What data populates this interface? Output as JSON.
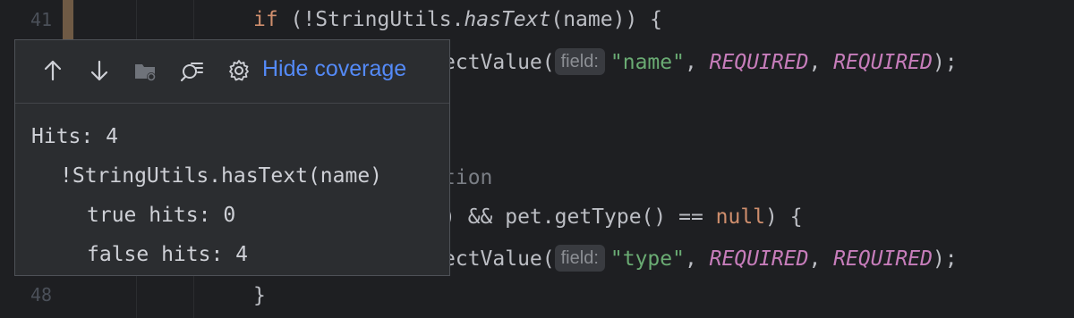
{
  "gutter": {
    "line_top": "41",
    "line_bottom": "48"
  },
  "code": {
    "line1": {
      "kw": "if",
      "p1": " (!StringUtils.",
      "method": "hasText",
      "p2": "(name)) {"
    },
    "line2": {
      "p1": "ectValue(",
      "hint": "field:",
      "str": "\"name\"",
      "sep1": ", ",
      "c1": "REQUIRED",
      "sep2": ", ",
      "c2": "REQUIRED",
      "end": ");"
    },
    "line4": {
      "comment": "tion"
    },
    "line5": {
      "p1": ") && pet.getType() == ",
      "kw": "null",
      "p2": ") {"
    },
    "line6": {
      "p1": "ectValue(",
      "hint": "field:",
      "str": "\"type\"",
      "sep1": ", ",
      "c1": "REQUIRED",
      "sep2": ", ",
      "c2": "REQUIRED",
      "end": ");"
    },
    "line7": {
      "brace": "}"
    }
  },
  "popup": {
    "toolbar": {
      "icons": [
        "arrow-up-icon",
        "arrow-down-icon",
        "folder-icon",
        "search-details-icon",
        "gear-icon"
      ],
      "hide_label": "Hide coverage"
    },
    "hits": "Hits: 4",
    "condition": "!StringUtils.hasText(name)",
    "true_hits": "true hits: 0",
    "false_hits": "false hits: 4"
  },
  "colors": {
    "background": "#1e1f22",
    "keyword": "#cf8e6d",
    "string": "#6aab73",
    "constant": "#c77dbb",
    "link": "#548af7",
    "coverage_marker": "#6f5a45"
  }
}
